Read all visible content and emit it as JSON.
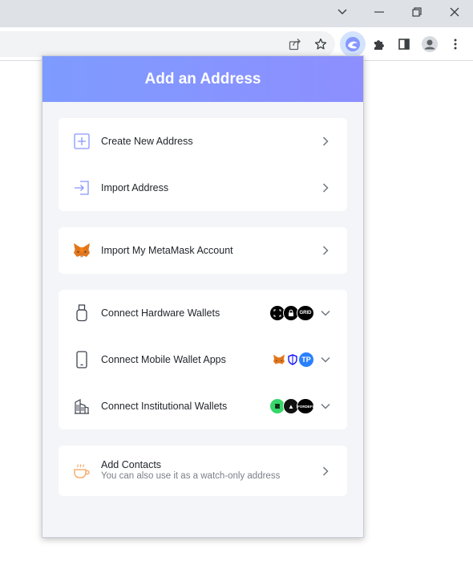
{
  "popup": {
    "title": "Add an Address"
  },
  "cards": {
    "create_new": "Create New Address",
    "import_address": "Import Address",
    "import_metamask": "Import My MetaMask Account",
    "hardware": "Connect Hardware Wallets",
    "mobile": "Connect Mobile Wallet Apps",
    "institutional": "Connect Institutional Wallets",
    "contacts_title": "Add Contacts",
    "contacts_sub": "You can also use it as a watch-only address"
  },
  "logo_text": {
    "tp": "TP",
    "gridplus": "GRID",
    "ar": "▲",
    "fordefi": "FORDEFI"
  },
  "colors": {
    "accent": "#8697ff",
    "header_start": "#7e9bff",
    "header_end": "#8d8fff",
    "contacts_orange": "#f5a25d"
  }
}
